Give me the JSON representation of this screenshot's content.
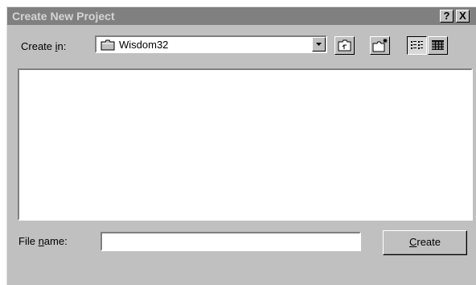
{
  "window": {
    "title": "Create New Project",
    "help_label": "?",
    "close_label": "X"
  },
  "create_in": {
    "label_prefix": "Create ",
    "label_accel": "i",
    "label_suffix": "n:",
    "value": "Wisdom32"
  },
  "toolbar": {
    "buttons": [
      "up-one-level",
      "create-new-folder",
      "list-view",
      "details-view"
    ],
    "active": "list-view"
  },
  "file_list": {
    "items": []
  },
  "file_name": {
    "label_prefix": "File ",
    "label_accel": "n",
    "label_suffix": "ame:",
    "value": ""
  },
  "create_button": {
    "label_accel": "C",
    "label_rest": "reate"
  }
}
